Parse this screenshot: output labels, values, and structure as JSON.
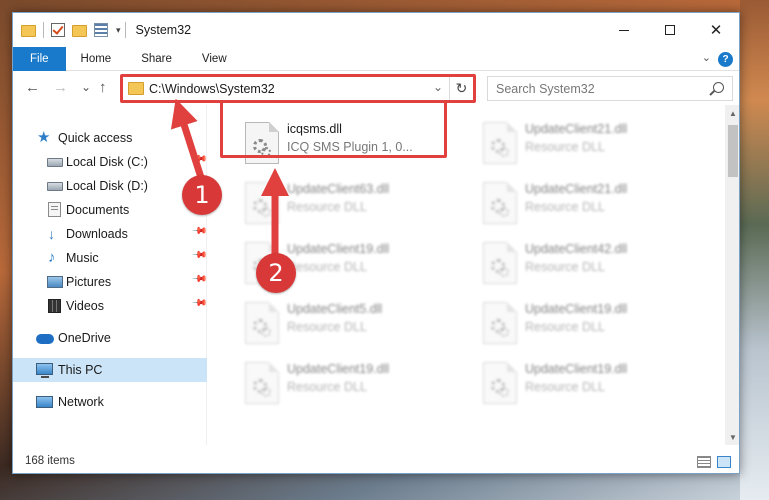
{
  "window": {
    "title": "System32",
    "minimize_glyph": "",
    "close_glyph": "✕"
  },
  "ribbon": {
    "tabs": [
      "File",
      "Home",
      "Share",
      "View"
    ],
    "help_glyph": "?"
  },
  "nav": {
    "back_glyph": "←",
    "forward_glyph": "→",
    "recent_glyph": "⌄",
    "up_glyph": "↑",
    "address": "C:\\Windows\\System32",
    "refresh_glyph": "↻",
    "search_placeholder": "Search System32"
  },
  "sidebar": {
    "items": [
      {
        "label": "Quick access",
        "icon": "star-icon",
        "pinned": false
      },
      {
        "label": "Local Disk (C:)",
        "icon": "disk-icon",
        "pinned": true
      },
      {
        "label": "Local Disk (D:)",
        "icon": "disk-icon",
        "pinned": false
      },
      {
        "label": "Documents",
        "icon": "documents-icon",
        "pinned": true
      },
      {
        "label": "Downloads",
        "icon": "download-icon",
        "pinned": true
      },
      {
        "label": "Music",
        "icon": "music-icon",
        "pinned": true
      },
      {
        "label": "Pictures",
        "icon": "pictures-icon",
        "pinned": true
      },
      {
        "label": "Videos",
        "icon": "videos-icon",
        "pinned": true
      },
      {
        "label": "OneDrive",
        "icon": "onedrive-icon",
        "pinned": false
      },
      {
        "label": "This PC",
        "icon": "pc-icon",
        "pinned": false,
        "selected": true
      },
      {
        "label": "Network",
        "icon": "network-icon",
        "pinned": false
      }
    ]
  },
  "files": [
    {
      "name": "icqsms.dll",
      "desc": "ICQ SMS Plugin 1, 0...",
      "highlighted": true
    },
    {
      "name": "UpdateClient21.dll",
      "desc": "Resource DLL"
    },
    {
      "name": "UpdateClient63.dll",
      "desc": "Resource DLL"
    },
    {
      "name": "UpdateClient21.dll",
      "desc": "Resource DLL"
    },
    {
      "name": "UpdateClient19.dll",
      "desc": "Resource DLL"
    },
    {
      "name": "UpdateClient42.dll",
      "desc": "Resource DLL"
    },
    {
      "name": "UpdateClient5.dll",
      "desc": "Resource DLL"
    },
    {
      "name": "UpdateClient19.dll",
      "desc": "Resource DLL"
    },
    {
      "name": "UpdateClient19.dll",
      "desc": "Resource DLL"
    },
    {
      "name": "UpdateClient19.dll",
      "desc": "Resource DLL"
    }
  ],
  "status": {
    "item_count": "168 items"
  },
  "annotations": {
    "step1": "1",
    "step2": "2",
    "accent_color": "#e0413e"
  },
  "colors": {
    "file_tab": "#1979ca",
    "selected": "#cce4f7"
  }
}
